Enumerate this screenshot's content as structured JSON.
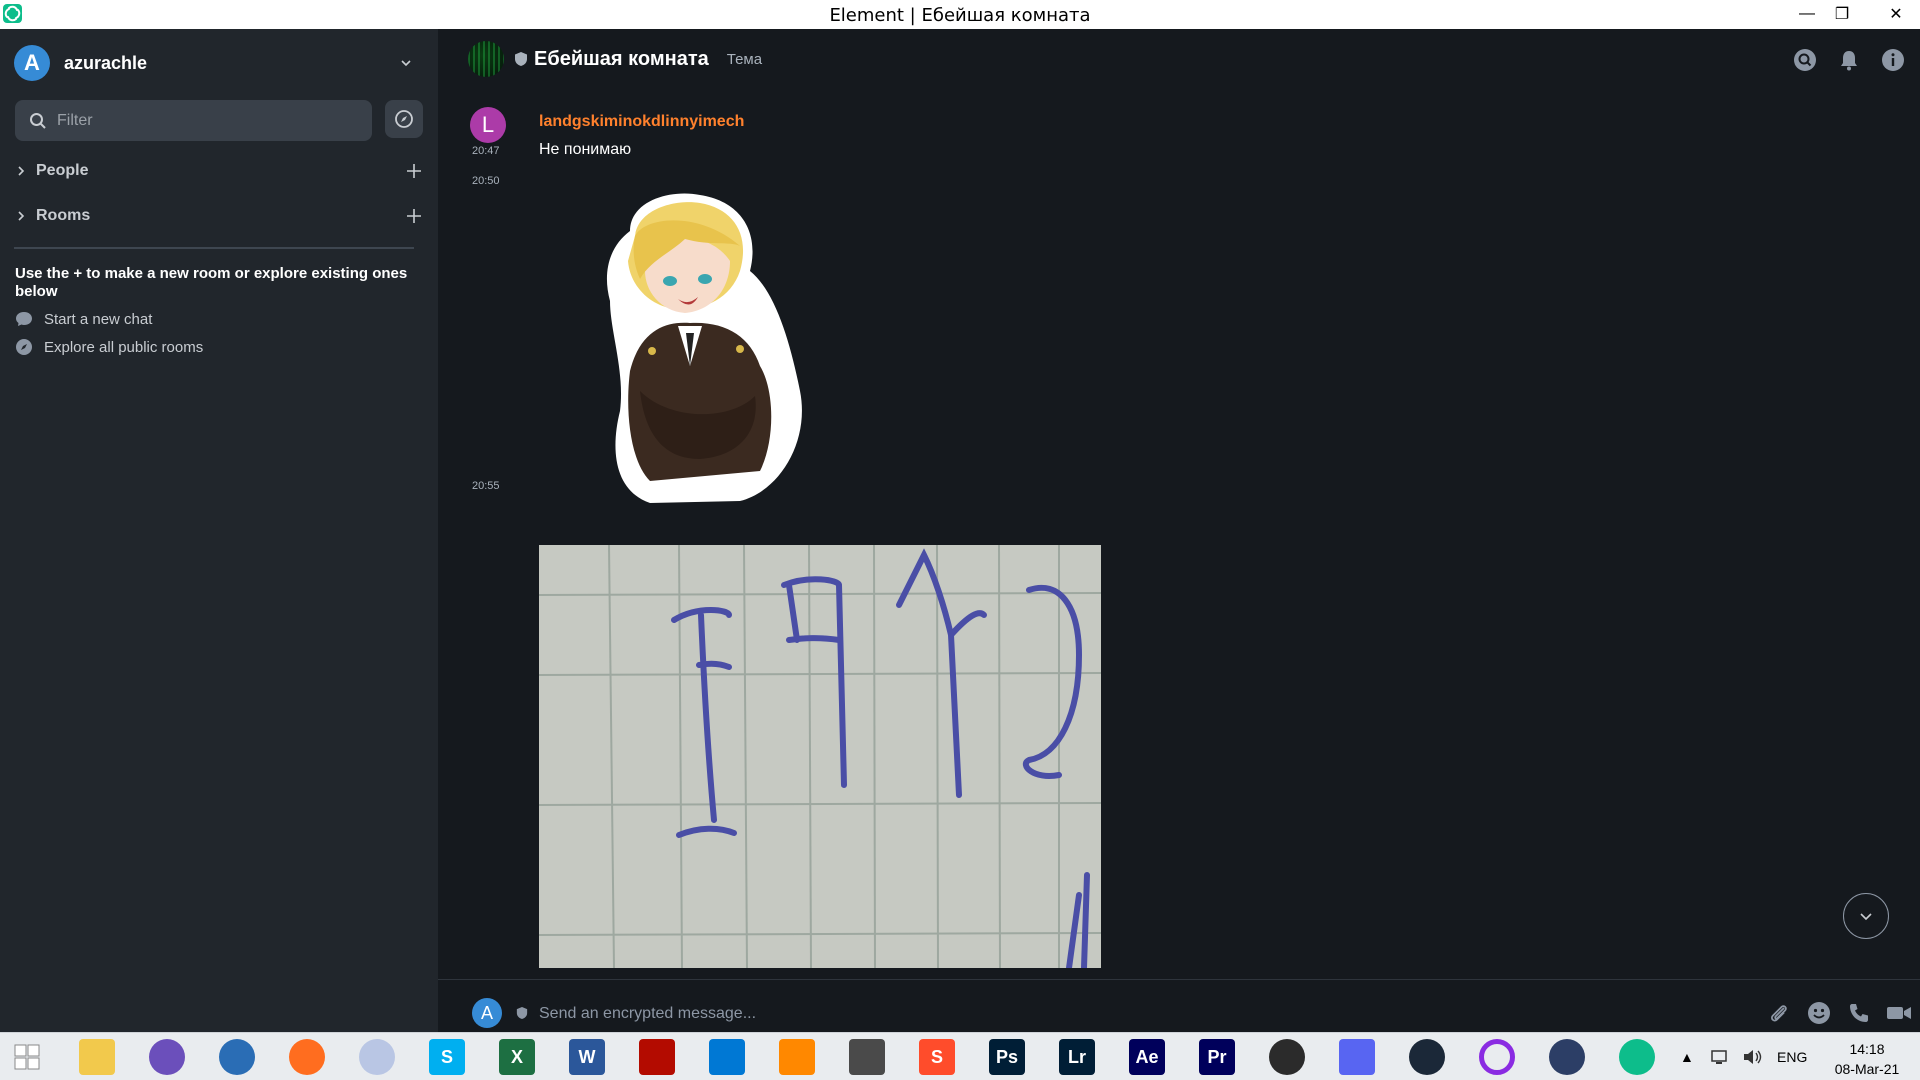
{
  "window": {
    "title": "Element | Ебейшая комната",
    "minimize_glyph": "—",
    "maximize_glyph": "❐",
    "close_glyph": "✕"
  },
  "sidebar": {
    "user_initial": "A",
    "user_name": "azurachle",
    "filter_placeholder": "Filter",
    "sections": [
      {
        "label": "People"
      },
      {
        "label": "Rooms"
      }
    ],
    "hint": "Use the + to make a new room or explore existing ones below",
    "links": [
      {
        "label": "Start a new chat",
        "icon": "chat-bubble-icon"
      },
      {
        "label": "Explore all public rooms",
        "icon": "compass-icon"
      }
    ]
  },
  "room": {
    "name": "Ебейшая комната",
    "topic": "Тема"
  },
  "timeline": {
    "messages": [
      {
        "sender_initial": "L",
        "sender": "landgskiminokdlinnyimech",
        "time": "20:47",
        "text": "Не понимаю"
      },
      {
        "time": "20:50",
        "type": "sticker"
      },
      {
        "time": "20:55",
        "type": "image"
      }
    ]
  },
  "composer": {
    "user_initial": "A",
    "placeholder": "Send an encrypted message..."
  },
  "taskbar": {
    "apps": [
      {
        "name": "windows-start",
        "label": "",
        "color": "#1e88e5"
      },
      {
        "name": "file-explorer",
        "label": "",
        "color": "#f2c94c"
      },
      {
        "name": "torrent",
        "label": "",
        "color": "#6b4fbb"
      },
      {
        "name": "browser-globe",
        "label": "",
        "color": "#2a6db5"
      },
      {
        "name": "firefox",
        "label": "",
        "color": "#ff6d1f"
      },
      {
        "name": "moon-app",
        "label": "",
        "color": "#b9c6e4"
      },
      {
        "name": "skype",
        "label": "S",
        "color": "#00aff0"
      },
      {
        "name": "excel",
        "label": "X",
        "color": "#1d6f42"
      },
      {
        "name": "word",
        "label": "W",
        "color": "#2b579a"
      },
      {
        "name": "acrobat",
        "label": "",
        "color": "#b30b00"
      },
      {
        "name": "vscode",
        "label": "",
        "color": "#0078d4"
      },
      {
        "name": "vlc",
        "label": "",
        "color": "#ff8800"
      },
      {
        "name": "downloader",
        "label": "",
        "color": "#4a4a4a"
      },
      {
        "name": "sublime",
        "label": "S",
        "color": "#ff4c2b"
      },
      {
        "name": "photoshop",
        "label": "Ps",
        "color": "#001e36"
      },
      {
        "name": "lightroom",
        "label": "Lr",
        "color": "#001e36"
      },
      {
        "name": "after-effects",
        "label": "Ae",
        "color": "#00005b"
      },
      {
        "name": "premiere",
        "label": "Pr",
        "color": "#00005b"
      },
      {
        "name": "obs",
        "label": "",
        "color": "#2b2b2b"
      },
      {
        "name": "discord",
        "label": "",
        "color": "#5865f2"
      },
      {
        "name": "steam",
        "label": "",
        "color": "#1b2838"
      },
      {
        "name": "cortana-ring",
        "label": "",
        "color": "#8a2be2"
      },
      {
        "name": "vpn-lock",
        "label": "",
        "color": "#2c3e66"
      },
      {
        "name": "element",
        "label": "",
        "color": "#0dbd8b"
      }
    ],
    "tray_up_arrow": "▲",
    "language": "ENG",
    "time": "14:18",
    "date": "08-Mar-21"
  }
}
